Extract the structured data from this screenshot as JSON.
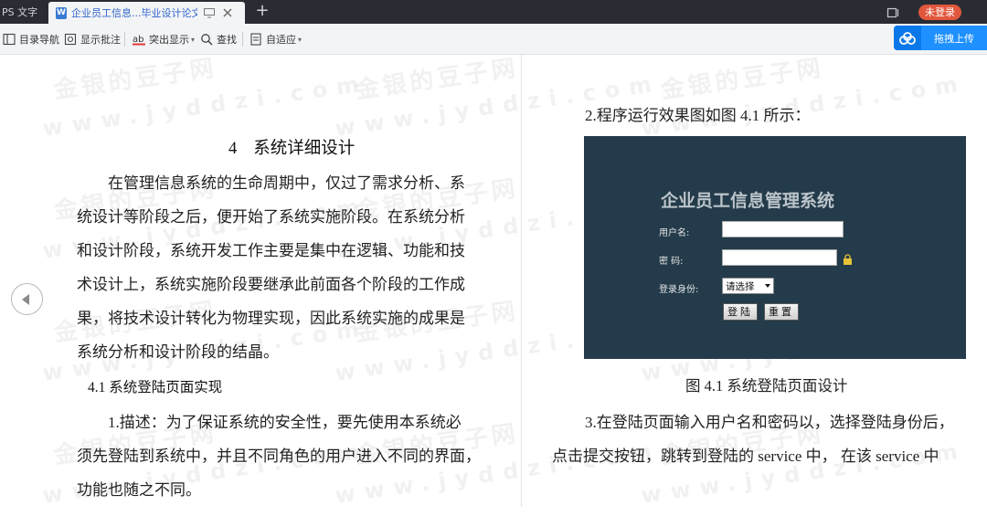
{
  "tabbar": {
    "app_tab_label": "PS 文字",
    "doc_tab_label": "企业员工信息...毕业设计论文",
    "doc_icon_letter": "W",
    "add_tab_symbol": "+",
    "login_badge": "未登录"
  },
  "toolbar": {
    "items": [
      {
        "label": "目录导航",
        "icon": "outline-icon"
      },
      {
        "label": "显示批注",
        "icon": "comment-icon"
      },
      {
        "label": "突出显示",
        "icon": "highlight-icon"
      },
      {
        "label": "查找",
        "icon": "search-icon"
      },
      {
        "label": "自适应",
        "icon": "fit-page-icon"
      }
    ],
    "upload_label": "拖拽上传"
  },
  "watermark": {
    "cn": "金银的豆子网",
    "en": "www.jyddzi.com"
  },
  "document": {
    "chapter_number": "4",
    "chapter_title": "系统详细设计",
    "left_lines": [
      "在管理信息系统的生命周期中，仅过了需求分析、系",
      "统设计等阶段之后，便开始了系统实施阶段。在系统分析",
      "和设计阶段，系统开发工作主要是集中在逻辑、功能和技",
      "术设计上，系统实施阶段要继承此前面各个阶段的工作成",
      "果，将技术设计转化为物理实现，因此系统实施的成果是",
      "系统分析和设计阶段的结晶。"
    ],
    "section_title": "4.1 系统登陆页面实现",
    "left_lines_2": [
      "1.描述：为了保证系统的安全性，要先使用本系统必",
      "须先登陆到系统中，并且不同角色的用户进入不同的界面，",
      "功能也随之不同。"
    ],
    "right_intro": "2.程序运行效果图如图 4.1 所示：",
    "figure": {
      "title": "企业员工信息管理系统",
      "username_label": "用户名:",
      "password_label": "密  码:",
      "role_label": "登录身份:",
      "role_select_value": "请选择",
      "login_button": "登陆",
      "reset_button": "重置"
    },
    "figure_caption": "图 4.1  系统登陆页面设计",
    "right_lines": [
      "3.在登陆页面输入用户名和密码以，选择登陆身份后，",
      "点击提交按钮，跳转到登陆的 service 中，  在该 service 中"
    ]
  },
  "colors": {
    "tabbar_bg": "#2a2c33",
    "toolbar_bg": "#f3f4f6",
    "accent_blue": "#1e90ff",
    "login_badge_bg": "#e0573d",
    "figure_bg": "#233b4a"
  }
}
